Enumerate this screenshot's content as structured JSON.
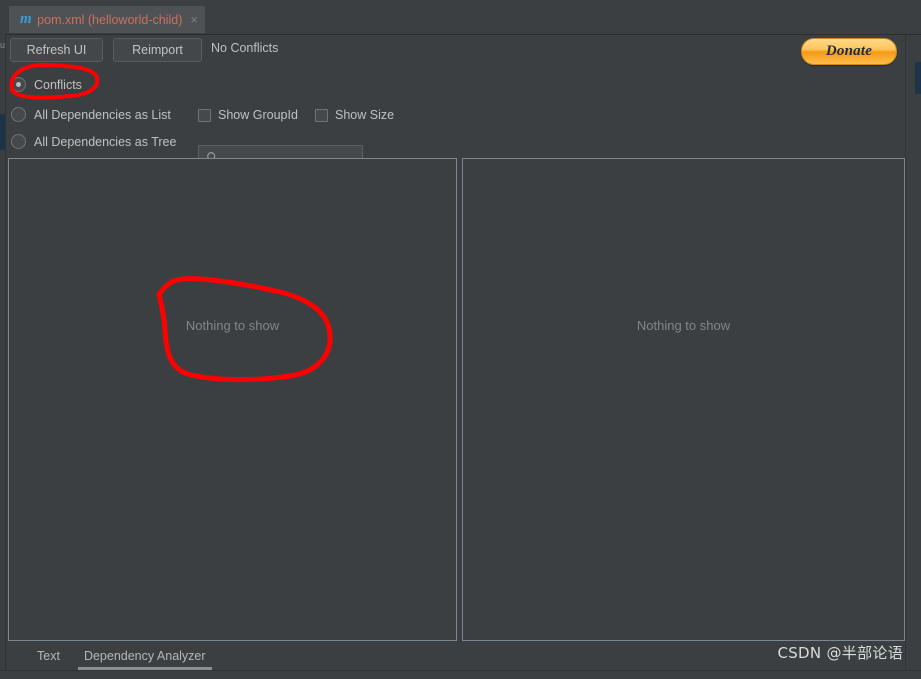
{
  "window": {
    "background_color": "#3c3f41",
    "accent_blue": "#1c3348",
    "annotation_color": "#fe0000"
  },
  "left_gutter": {
    "letter": "u"
  },
  "tab_bar": {
    "tabs": [
      {
        "icon": "maven-m-icon",
        "icon_glyph": "m",
        "title": "pom.xml (helloworld-child)",
        "close_glyph": "×",
        "active": true,
        "title_color": "#cd6f5e",
        "icon_color": "#3d9ad4"
      }
    ]
  },
  "toolbar": {
    "refresh_label": "Refresh UI",
    "reimport_label": "Reimport",
    "status_label": "No Conflicts",
    "donate_label": "Donate",
    "donate_color": "#f59a15"
  },
  "options": {
    "radios": [
      {
        "label": "Conflicts",
        "checked": true
      },
      {
        "label": "All Dependencies as List",
        "checked": false
      },
      {
        "label": "All Dependencies as Tree",
        "checked": false
      }
    ],
    "checkboxes": [
      {
        "label": "Show GroupId",
        "checked": false
      },
      {
        "label": "Show Size",
        "checked": false
      }
    ]
  },
  "search": {
    "value": "",
    "placeholder": "",
    "icon": "search-icon"
  },
  "panels": {
    "left": {
      "empty_message": "Nothing to show"
    },
    "right": {
      "empty_message": "Nothing to show"
    }
  },
  "bottom_tabs": {
    "tabs": [
      {
        "label": "Text",
        "active": false
      },
      {
        "label": "Dependency Analyzer",
        "active": true
      }
    ]
  },
  "watermark": {
    "text": "CSDN @半部论语"
  },
  "annotations": [
    {
      "name": "conflicts-highlight",
      "shape": "ellipse"
    },
    {
      "name": "nothing-to-show-highlight",
      "shape": "blob"
    }
  ]
}
